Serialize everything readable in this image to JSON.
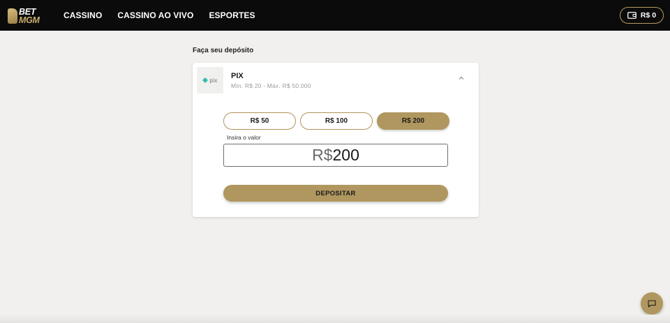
{
  "header": {
    "logo": {
      "line1": "BET",
      "line2": "MGM"
    },
    "nav": [
      "CASSINO",
      "CASSINO AO VIVO",
      "ESPORTES"
    ],
    "wallet": {
      "label": "R$ 0",
      "icon": "wallet-icon"
    }
  },
  "deposit": {
    "title": "Faça seu depósito",
    "method": {
      "logo_text": "pix",
      "name": "PIX",
      "limits": "Mín. R$ 20 - Máx. R$ 50.000"
    },
    "amount_options": [
      {
        "label": "R$ 50",
        "selected": false
      },
      {
        "label": "R$ 100",
        "selected": false
      },
      {
        "label": "R$ 200",
        "selected": true
      }
    ],
    "input": {
      "label": "Insira o valor",
      "currency": "R$",
      "value": "200"
    },
    "submit_label": "DEPOSITAR"
  },
  "chat": {
    "icon": "chat-icon"
  },
  "colors": {
    "accent": "#b0975f",
    "header_bg": "#0b0b0b",
    "page_bg": "#f1f0ee",
    "pix_teal": "#32bcad"
  }
}
